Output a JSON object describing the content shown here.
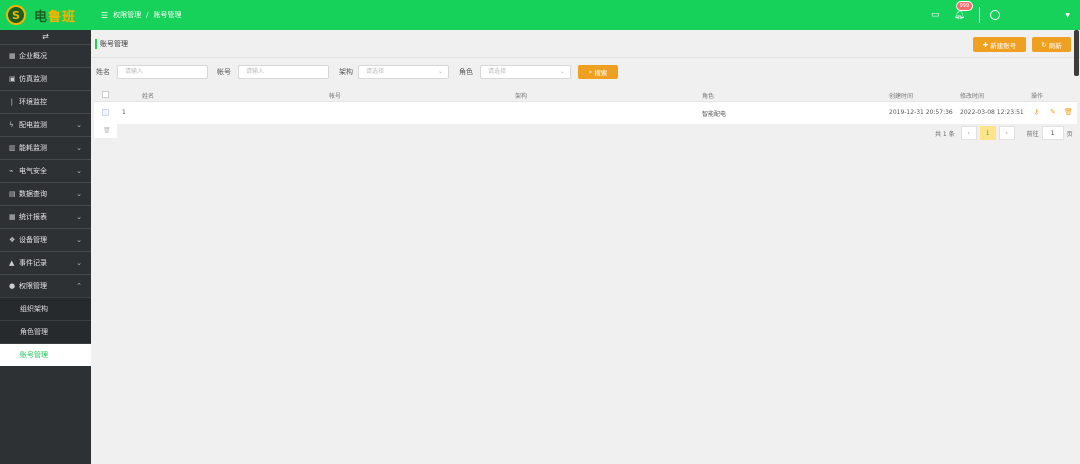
{
  "brand": {
    "logo_glyph": "S",
    "name_part1": "电",
    "name_part2": "鲁班"
  },
  "header": {
    "breadcrumb": [
      "权限管理",
      "账号管理"
    ],
    "breadcrumb_sep": "/",
    "notification_count": "999",
    "accent_color": "#16d15a"
  },
  "sidebar": {
    "toggle_icon": "⇄",
    "items": [
      {
        "label": "企业概况",
        "icon": "dashboard-icon",
        "expandable": false
      },
      {
        "label": "仿真监测",
        "icon": "monitor-icon",
        "expandable": false
      },
      {
        "label": "环境监控",
        "icon": "thermometer-icon",
        "expandable": false
      },
      {
        "label": "配电监测",
        "icon": "lightning-icon",
        "expandable": true
      },
      {
        "label": "能耗监测",
        "icon": "chart-icon",
        "expandable": true
      },
      {
        "label": "电气安全",
        "icon": "plug-icon",
        "expandable": true
      },
      {
        "label": "数据查询",
        "icon": "calculator-icon",
        "expandable": true
      },
      {
        "label": "统计报表",
        "icon": "table-icon",
        "expandable": true
      },
      {
        "label": "设备管理",
        "icon": "cubes-icon",
        "expandable": true
      },
      {
        "label": "事件记录",
        "icon": "warning-icon",
        "expandable": true
      },
      {
        "label": "权限管理",
        "icon": "users-icon",
        "expandable": true,
        "expanded": true
      }
    ],
    "sub_items": [
      {
        "label": "组织架构",
        "active": false
      },
      {
        "label": "角色管理",
        "active": false
      },
      {
        "label": "账号管理",
        "active": true
      }
    ]
  },
  "page": {
    "title": "账号管理",
    "add_button": "新建账号",
    "refresh_button": "刷新"
  },
  "filters": {
    "name_label": "姓名",
    "name_placeholder": "请输入",
    "account_label": "帐号",
    "account_placeholder": "请输入",
    "org_label": "架构",
    "org_placeholder": "请选择",
    "role_label": "角色",
    "role_placeholder": "请选择",
    "search_button": "搜索"
  },
  "table": {
    "columns": [
      "姓名",
      "帐号",
      "架构",
      "角色",
      "创建时间",
      "修改时间",
      "操作"
    ],
    "rows": [
      {
        "index": "1",
        "name": "",
        "account": "",
        "org": "",
        "role": "智能配电",
        "created": "2019-12-31 20:57:36",
        "modified": "2022-03-08 12:23:51"
      }
    ]
  },
  "pagination": {
    "total": "共 1 条",
    "prev": "‹",
    "current_page": "1",
    "next": "›",
    "goto_label": "前往",
    "goto_value": "1",
    "page_suffix": "页"
  }
}
